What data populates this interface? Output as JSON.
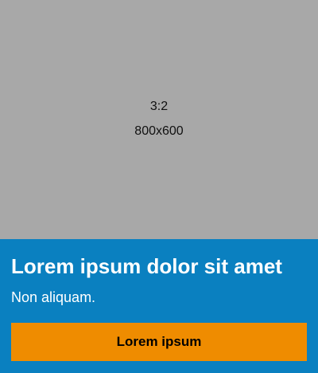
{
  "media": {
    "ratio": "3:2",
    "dimensions": "800x600"
  },
  "card": {
    "title": "Lorem ipsum dolor sit amet",
    "subtitle": "Non aliquam.",
    "button_label": "Lorem ipsum"
  },
  "colors": {
    "placeholder_background": "#a8a8a8",
    "card_background": "#0a80c0",
    "button_background": "#ef8c00",
    "heading_text": "#ffffff",
    "button_text": "#000000"
  }
}
